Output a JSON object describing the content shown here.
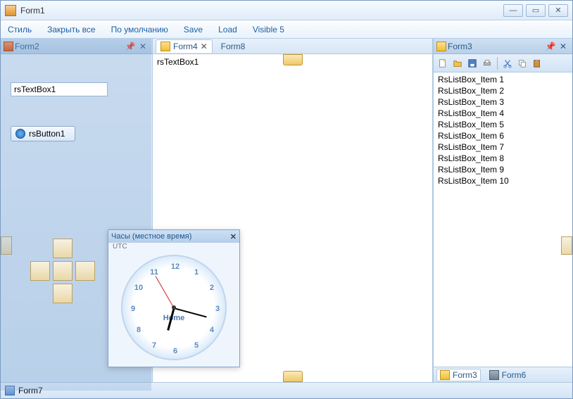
{
  "window": {
    "title": "Form1"
  },
  "menu": {
    "style": "Стиль",
    "closeAll": "Закрыть все",
    "default": "По умолчанию",
    "save": "Save",
    "load": "Load",
    "visible5": "Visible 5"
  },
  "left": {
    "title": "Form2",
    "textbox": "rsTextBox1",
    "button": "rsButton1"
  },
  "center": {
    "tab1": "Form4",
    "tab2": "Form8",
    "text": "rsTextBox1"
  },
  "right": {
    "title": "Form3",
    "items": [
      "RsListBox_Item 1",
      "RsListBox_Item 2",
      "RsListBox_Item 3",
      "RsListBox_Item 4",
      "RsListBox_Item 5",
      "RsListBox_Item 6",
      "RsListBox_Item 7",
      "RsListBox_Item 8",
      "RsListBox_Item 9",
      "RsListBox_Item 10"
    ],
    "tabA": "Form3",
    "tabB": "Form6"
  },
  "floating": {
    "title": "Часы (местное время)",
    "sub": "UTC",
    "label": "Home"
  },
  "clock": {
    "numbers": [
      "12",
      "1",
      "2",
      "3",
      "4",
      "5",
      "6",
      "7",
      "8",
      "9",
      "10",
      "11"
    ],
    "hourAngle": 195,
    "minAngle": 105,
    "secAngle": 330
  },
  "footer": {
    "label": "Form7"
  }
}
